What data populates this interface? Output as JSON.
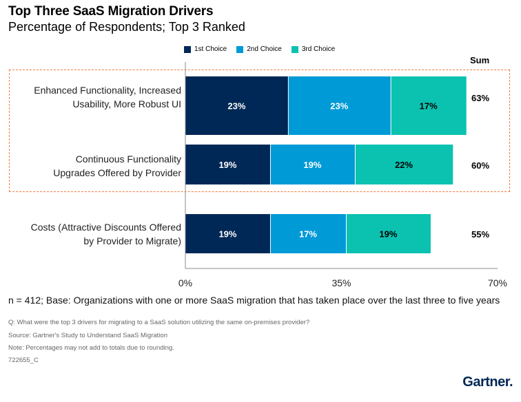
{
  "header": {
    "title": "Top Three SaaS Migration Drivers",
    "subtitle": "Percentage of Respondents; Top 3 Ranked"
  },
  "chart_data": {
    "type": "bar",
    "orientation": "horizontal",
    "stacked": true,
    "title": "Top Three SaaS Migration Drivers",
    "subtitle": "Percentage of Respondents; Top 3 Ranked",
    "categories": [
      "Enhanced Functionality, Increased Usability, More Robust UI",
      "Continuous Functionality Upgrades Offered by Provider",
      "Costs (Attractive Discounts Offered by Provider to Migrate)"
    ],
    "category_lines": [
      [
        "Enhanced Functionality, Increased",
        "Usability, More Robust UI"
      ],
      [
        "Continuous Functionality",
        "Upgrades Offered by Provider"
      ],
      [
        "Costs (Attractive Discounts Offered",
        "by Provider to Migrate)"
      ]
    ],
    "series": [
      {
        "name": "1st Choice",
        "color": "#002856",
        "label_color": "#ffffff",
        "values": [
          23,
          19,
          19
        ]
      },
      {
        "name": "2nd Choice",
        "color": "#009ad7",
        "label_color": "#ffffff",
        "values": [
          23,
          19,
          17
        ]
      },
      {
        "name": "3rd Choice",
        "color": "#0bc2b0",
        "label_color": "#000000",
        "values": [
          17,
          22,
          19
        ]
      }
    ],
    "sum_header": "Sum",
    "sums": [
      "63%",
      "60%",
      "55%"
    ],
    "xlim": [
      0,
      70
    ],
    "xticks": [
      "0%",
      "35%",
      "70%"
    ],
    "xtick_values": [
      0,
      35,
      70
    ],
    "legend_position": "top",
    "grid": false,
    "highlighted_categories": [
      0,
      1
    ],
    "highlight_color": "#f07a3a"
  },
  "footer": {
    "base": "n = 412; Base: Organizations with one or more SaaS migration that has taken place over the last three to five years",
    "question": "Q: What were the top 3 drivers for migrating to a SaaS solution utilizing the same on-premises provider?",
    "source": "Source: Gartner's Study to Understand SaaS Migration",
    "note": "Note: Percentages may not add to totals due to rounding.",
    "id": "722655_C",
    "logo": "Gartner."
  }
}
